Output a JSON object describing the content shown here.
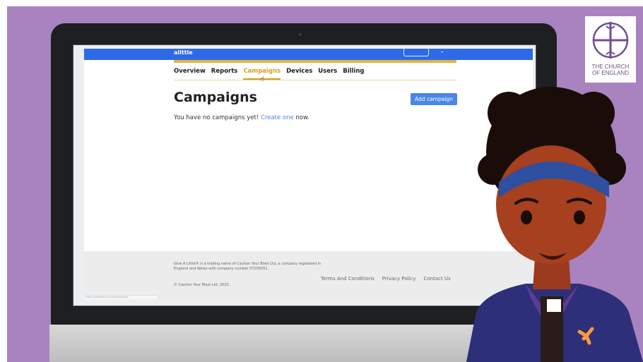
{
  "app": {
    "brand": "alittle",
    "status_bar_text": "https://givealittle.co.uk/campaigns"
  },
  "nav": {
    "items": [
      {
        "label": "Overview",
        "active": false
      },
      {
        "label": "Reports",
        "active": false
      },
      {
        "label": "Campaigns",
        "active": true
      },
      {
        "label": "Devices",
        "active": false
      },
      {
        "label": "Users",
        "active": false
      },
      {
        "label": "Billing",
        "active": false
      }
    ]
  },
  "main": {
    "title": "Campaigns",
    "add_button": "Add campaign",
    "empty_prefix": "You have no campaigns yet! ",
    "empty_link": "Create one",
    "empty_suffix": " now."
  },
  "footer": {
    "legal": "Give A Little® is a trading name of Caution Your Blast Ltd, a company registered in England and Wales with company number 07205051.",
    "copyright": "© Caution Your Blast Ltd, 2020.",
    "links": [
      "Terms And Conditions",
      "Privacy Policy",
      "Contact Us"
    ]
  },
  "overlay": {
    "logo_line1": "THE CHURCH",
    "logo_line2": "OF ENGLAND"
  },
  "colors": {
    "background": "#a883bf",
    "brand_blue": "#2f6ae6",
    "accent_gold": "#d4a21f",
    "button_blue": "#4a86e8",
    "logo_purple": "#6f4f93"
  },
  "icons": [
    "pointer-cursor-icon",
    "church-cross-icon"
  ]
}
